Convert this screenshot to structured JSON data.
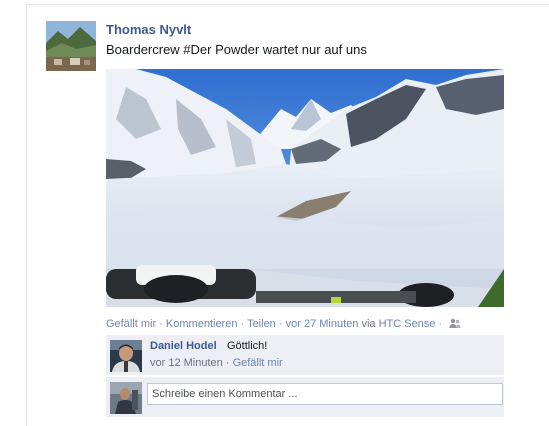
{
  "post": {
    "author": "Thomas Nyvlt",
    "text": "Boardercrew #Der Powder wartet nur auf uns",
    "photo_icon": "snowy-mountain-photo"
  },
  "actions": {
    "like": "Gefällt mir",
    "comment": "Kommentieren",
    "share": "Teilen",
    "time": "vor 27 Minuten",
    "via": "via",
    "app": "HTC Sense",
    "sep": "·",
    "audience_icon": "friends-icon"
  },
  "comments": [
    {
      "author": "Daniel Hodel",
      "text": "Göttlich!",
      "time": "vor 12 Minuten",
      "like": "Gefällt mir"
    }
  ],
  "compose": {
    "placeholder": "Schreibe einen Kommentar ..."
  },
  "colors": {
    "link": "#3b5998",
    "comment_bg": "#edeff4"
  }
}
